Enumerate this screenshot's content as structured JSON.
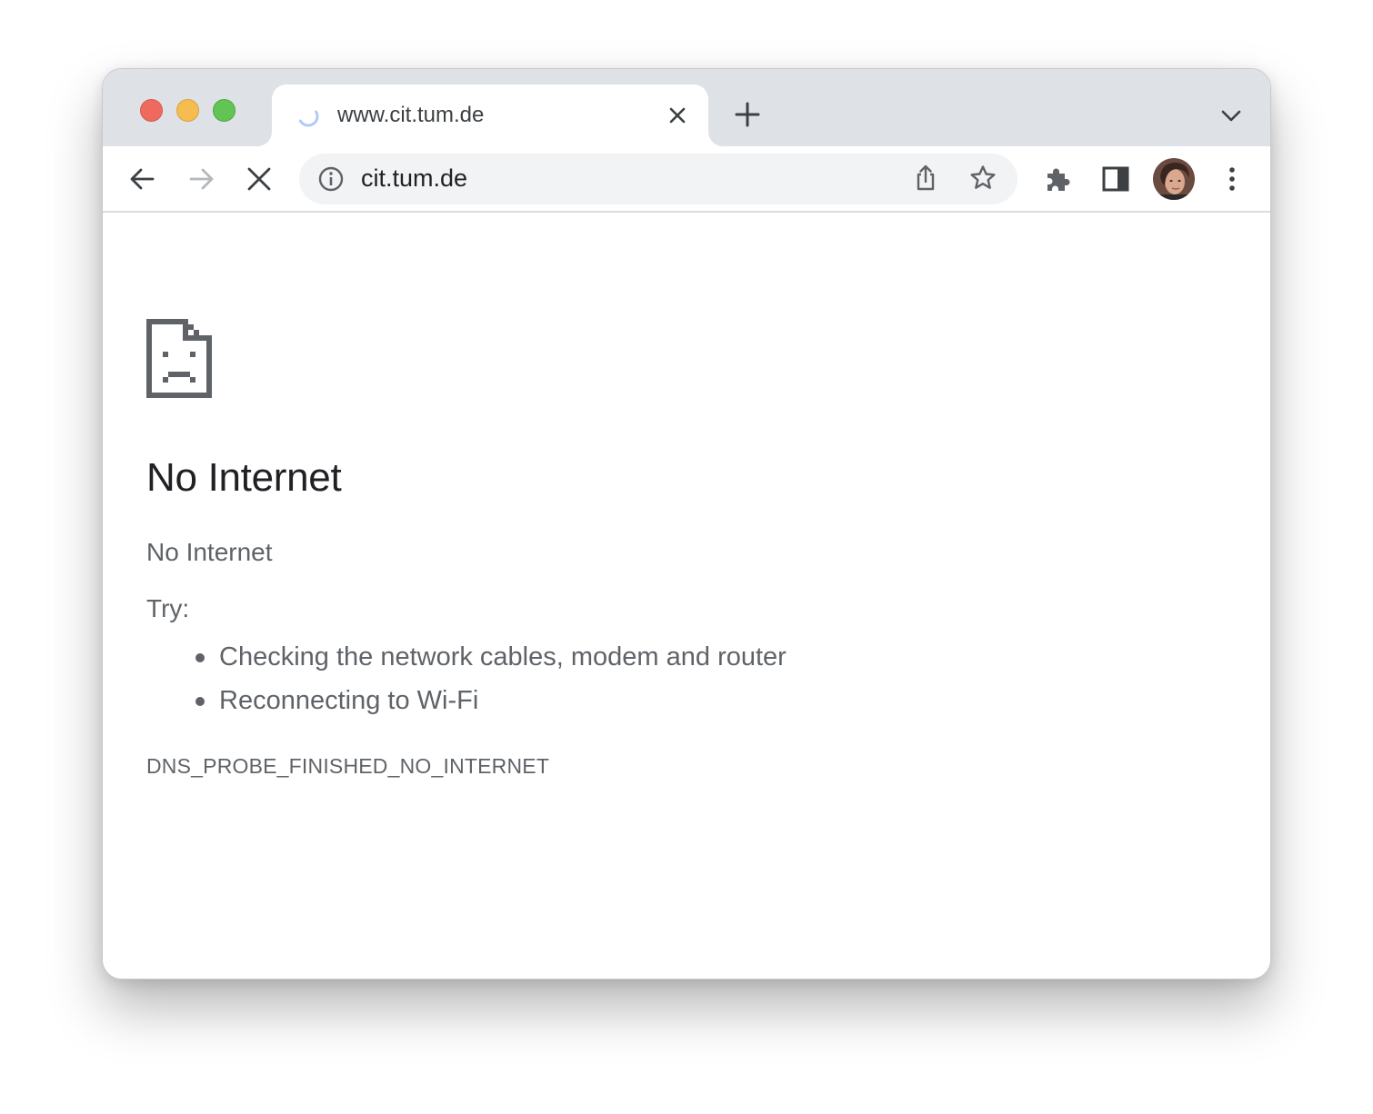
{
  "tab": {
    "title": "www.cit.tum.de",
    "loading": true
  },
  "omnibox": {
    "url": "cit.tum.de"
  },
  "icons": {
    "traffic_lights": [
      "close-window-icon",
      "minimize-window-icon",
      "zoom-window-icon"
    ],
    "tab": [
      "loading-spinner-icon",
      "close-tab-icon"
    ],
    "tabstrip": [
      "new-tab-icon",
      "tab-search-icon"
    ],
    "toolbar": [
      "back-icon",
      "forward-icon",
      "stop-loading-icon",
      "site-info-icon",
      "share-icon",
      "bookmark-star-icon",
      "extensions-puzzle-icon",
      "side-panel-icon",
      "profile-avatar",
      "more-menu-icon"
    ],
    "page": [
      "sad-page-icon"
    ]
  },
  "error": {
    "title": "No Internet",
    "subtitle": "No Internet",
    "try_label": "Try:",
    "suggestions": [
      "Checking the network cables, modem and router",
      "Reconnecting to Wi-Fi"
    ],
    "code": "DNS_PROBE_FINISHED_NO_INTERNET"
  },
  "colors": {
    "tabstrip_bg": "#dee1e6",
    "omnibox_bg": "#f1f3f4",
    "title_text": "#202124",
    "body_text": "#5f6368",
    "traffic_red": "#ee6a5f",
    "traffic_yellow": "#f5bd4f",
    "traffic_green": "#61c454"
  }
}
